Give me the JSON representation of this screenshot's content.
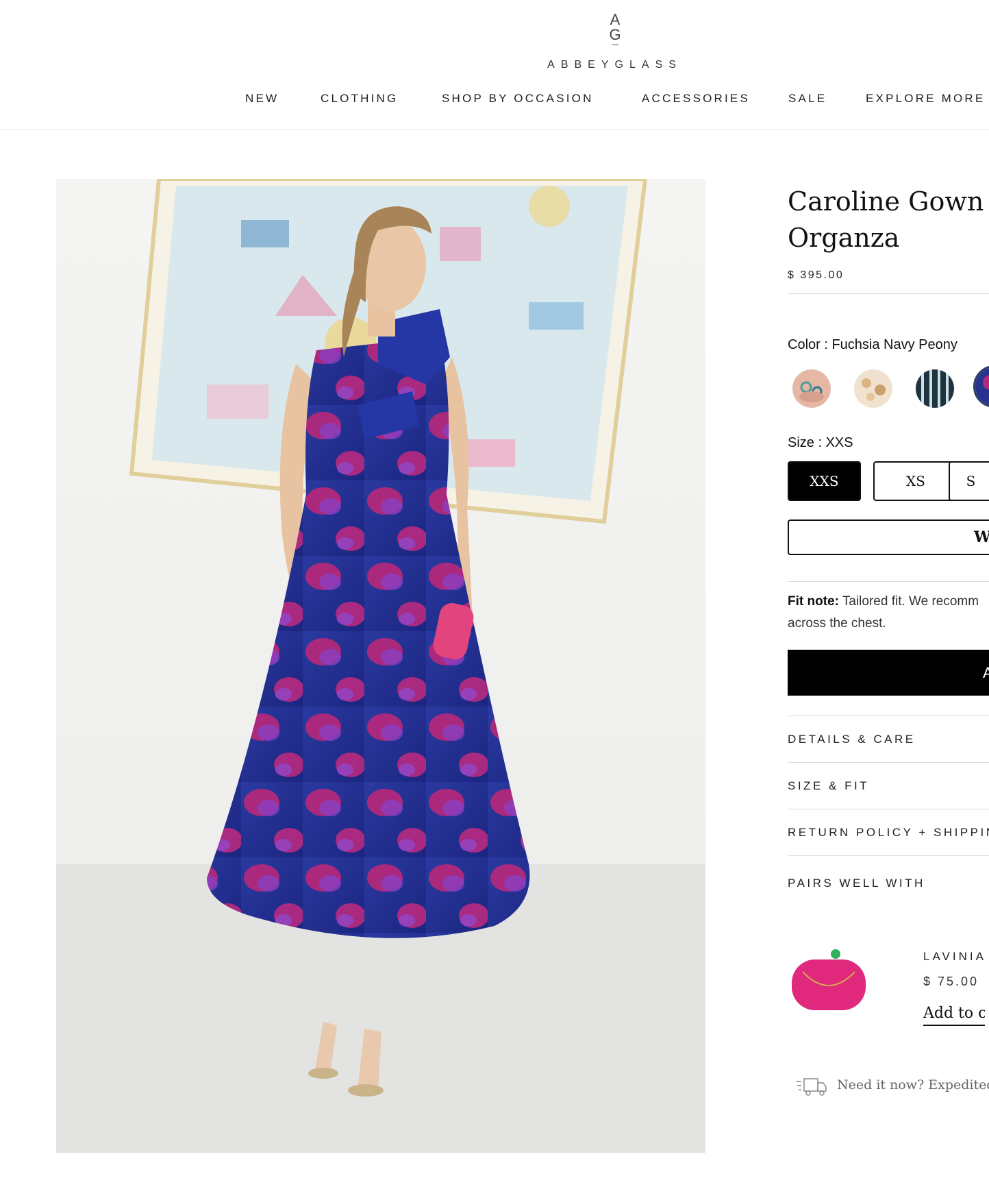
{
  "brand": {
    "mark_top": "A",
    "mark_bottom": "G",
    "name": "ABBEYGLASS"
  },
  "nav": [
    "NEW",
    "CLOTHING",
    "SHOP BY OCCASION",
    "ACCESSORIES",
    "SALE",
    "EXPLORE MORE"
  ],
  "product": {
    "title_line1": "Caroline Gown F",
    "title_line2": "Organza",
    "price": "$ 395.00",
    "color_label": "Color : Fuchsia Navy Peony",
    "swatches": [
      "rings",
      "gold-floral",
      "navy-stripe",
      "fuchsia-navy-peony"
    ],
    "size_label": "Size : XXS",
    "sizes": [
      "XXS",
      "XS",
      "S"
    ],
    "selected_size": "XXS",
    "wishlist_label": "W",
    "fit_note_bold": "Fit note:",
    "fit_note_line1": " Tailored fit. We recomm",
    "fit_note_line2": "across the chest.",
    "add_to_cart_label": "A"
  },
  "accordion": [
    "DETAILS & CARE",
    "SIZE & FIT",
    "RETURN POLICY + SHIPPIN"
  ],
  "pairs": {
    "heading": "PAIRS WELL WITH",
    "item_name": "LAVINIA",
    "item_price": "$ 75.00",
    "item_add": "Add to car"
  },
  "shipping_note": "Need it now? Expedited s",
  "colors": {
    "accent": "#000000",
    "dress_navy": "#22308c",
    "dress_fuchsia": "#c2277a"
  }
}
